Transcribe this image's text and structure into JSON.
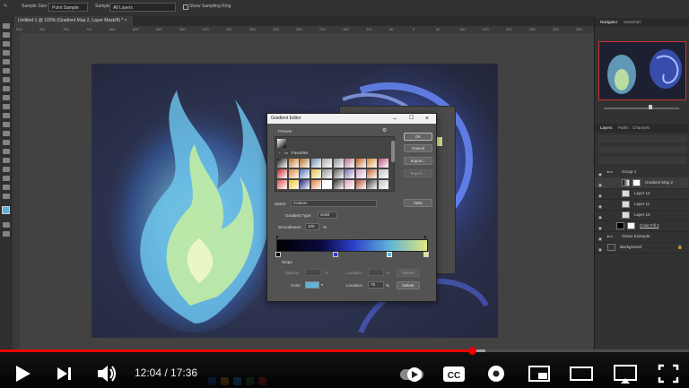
{
  "options_bar": {
    "sample_size_label": "Sample Size:",
    "sample_size_value": "Point Sample",
    "sample_label": "Sample:",
    "sample_value": "All Layers",
    "show_sampling_ring": "Show Sampling Ring"
  },
  "document": {
    "tab_title": "Untitled-1 @ 100% (Gradient Map 2, Layer Mask/8) *",
    "ruler_ticks": [
      "900",
      "950",
      "750",
      "700",
      "650",
      "600",
      "550",
      "500",
      "450",
      "400",
      "350",
      "300",
      "250",
      "200",
      "150",
      "100",
      "50",
      "0",
      "50",
      "100",
      "150",
      "200",
      "250",
      "300",
      "350"
    ]
  },
  "right_panel": {
    "nav_tabs": [
      "Navigator",
      "Swatches"
    ],
    "layer_tabs": [
      "Layers",
      "Paths",
      "Channels"
    ],
    "layers": [
      {
        "name": "Group 1",
        "type": "group"
      },
      {
        "name": "Gradient Map 2",
        "type": "adjust",
        "selected": true
      },
      {
        "name": "Layer 12",
        "type": "layer"
      },
      {
        "name": "Layer 11",
        "type": "layer"
      },
      {
        "name": "Layer 10",
        "type": "layer"
      },
      {
        "name": "Color Fill 2",
        "type": "fill"
      },
      {
        "name": "Glows Example",
        "type": "group"
      },
      {
        "name": "Background",
        "type": "bg"
      }
    ]
  },
  "gradient_editor": {
    "title": "Gradient Editor",
    "presets_label": "Presets",
    "folder_label": "Favorites",
    "ok": "OK",
    "cancel": "Cancel",
    "import": "Import...",
    "export": "Export...",
    "name_label": "Name:",
    "name_value": "Custom",
    "new_button": "New",
    "gradient_type_label": "Gradient Type:",
    "gradient_type_value": "Solid",
    "smoothness_label": "Smoothness:",
    "smoothness_value": "100",
    "percent": "%",
    "stops_label": "Stops",
    "opacity_label": "Opacity:",
    "location_label": "Location:",
    "delete_label": "Delete",
    "color_label": "Color:",
    "color_location_value": "75",
    "stop_color": "#5fb3d8",
    "preset_swatches": [
      [
        "#1a1a1a",
        "#b8731a",
        "#b46a2a",
        "#6b8db0",
        "#a9a9a9",
        "#8c8c8c",
        "#b07090",
        "#c06020",
        "#d08a30",
        "#c05080"
      ],
      [
        "#c02020",
        "#e08030",
        "#5070b0",
        "#e0c040",
        "#909090",
        "#5a5a5a",
        "#7a6ab0",
        "#d0a0c0",
        "#c06030",
        "#c0c0c0"
      ],
      [
        "#e05050",
        "#f0c020",
        "#202080",
        "#e08040",
        "#ffffff",
        "#303030",
        "#e0a0c0",
        "#b05030",
        "#404040",
        "#c0c0c0"
      ]
    ]
  },
  "player": {
    "time_current": "12:04",
    "time_total": "17:36",
    "progress_played": 0.685,
    "progress_buffered": 0.705
  }
}
